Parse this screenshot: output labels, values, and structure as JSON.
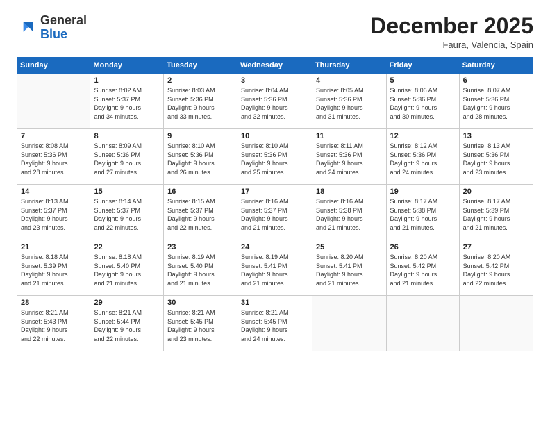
{
  "logo": {
    "line1": "General",
    "line2": "Blue"
  },
  "header": {
    "month": "December 2025",
    "location": "Faura, Valencia, Spain"
  },
  "weekdays": [
    "Sunday",
    "Monday",
    "Tuesday",
    "Wednesday",
    "Thursday",
    "Friday",
    "Saturday"
  ],
  "weeks": [
    [
      {
        "day": "",
        "info": ""
      },
      {
        "day": "1",
        "info": "Sunrise: 8:02 AM\nSunset: 5:37 PM\nDaylight: 9 hours\nand 34 minutes."
      },
      {
        "day": "2",
        "info": "Sunrise: 8:03 AM\nSunset: 5:36 PM\nDaylight: 9 hours\nand 33 minutes."
      },
      {
        "day": "3",
        "info": "Sunrise: 8:04 AM\nSunset: 5:36 PM\nDaylight: 9 hours\nand 32 minutes."
      },
      {
        "day": "4",
        "info": "Sunrise: 8:05 AM\nSunset: 5:36 PM\nDaylight: 9 hours\nand 31 minutes."
      },
      {
        "day": "5",
        "info": "Sunrise: 8:06 AM\nSunset: 5:36 PM\nDaylight: 9 hours\nand 30 minutes."
      },
      {
        "day": "6",
        "info": "Sunrise: 8:07 AM\nSunset: 5:36 PM\nDaylight: 9 hours\nand 28 minutes."
      }
    ],
    [
      {
        "day": "7",
        "info": "Sunrise: 8:08 AM\nSunset: 5:36 PM\nDaylight: 9 hours\nand 28 minutes."
      },
      {
        "day": "8",
        "info": "Sunrise: 8:09 AM\nSunset: 5:36 PM\nDaylight: 9 hours\nand 27 minutes."
      },
      {
        "day": "9",
        "info": "Sunrise: 8:10 AM\nSunset: 5:36 PM\nDaylight: 9 hours\nand 26 minutes."
      },
      {
        "day": "10",
        "info": "Sunrise: 8:10 AM\nSunset: 5:36 PM\nDaylight: 9 hours\nand 25 minutes."
      },
      {
        "day": "11",
        "info": "Sunrise: 8:11 AM\nSunset: 5:36 PM\nDaylight: 9 hours\nand 24 minutes."
      },
      {
        "day": "12",
        "info": "Sunrise: 8:12 AM\nSunset: 5:36 PM\nDaylight: 9 hours\nand 24 minutes."
      },
      {
        "day": "13",
        "info": "Sunrise: 8:13 AM\nSunset: 5:36 PM\nDaylight: 9 hours\nand 23 minutes."
      }
    ],
    [
      {
        "day": "14",
        "info": "Sunrise: 8:13 AM\nSunset: 5:37 PM\nDaylight: 9 hours\nand 23 minutes."
      },
      {
        "day": "15",
        "info": "Sunrise: 8:14 AM\nSunset: 5:37 PM\nDaylight: 9 hours\nand 22 minutes."
      },
      {
        "day": "16",
        "info": "Sunrise: 8:15 AM\nSunset: 5:37 PM\nDaylight: 9 hours\nand 22 minutes."
      },
      {
        "day": "17",
        "info": "Sunrise: 8:16 AM\nSunset: 5:37 PM\nDaylight: 9 hours\nand 21 minutes."
      },
      {
        "day": "18",
        "info": "Sunrise: 8:16 AM\nSunset: 5:38 PM\nDaylight: 9 hours\nand 21 minutes."
      },
      {
        "day": "19",
        "info": "Sunrise: 8:17 AM\nSunset: 5:38 PM\nDaylight: 9 hours\nand 21 minutes."
      },
      {
        "day": "20",
        "info": "Sunrise: 8:17 AM\nSunset: 5:39 PM\nDaylight: 9 hours\nand 21 minutes."
      }
    ],
    [
      {
        "day": "21",
        "info": "Sunrise: 8:18 AM\nSunset: 5:39 PM\nDaylight: 9 hours\nand 21 minutes."
      },
      {
        "day": "22",
        "info": "Sunrise: 8:18 AM\nSunset: 5:40 PM\nDaylight: 9 hours\nand 21 minutes."
      },
      {
        "day": "23",
        "info": "Sunrise: 8:19 AM\nSunset: 5:40 PM\nDaylight: 9 hours\nand 21 minutes."
      },
      {
        "day": "24",
        "info": "Sunrise: 8:19 AM\nSunset: 5:41 PM\nDaylight: 9 hours\nand 21 minutes."
      },
      {
        "day": "25",
        "info": "Sunrise: 8:20 AM\nSunset: 5:41 PM\nDaylight: 9 hours\nand 21 minutes."
      },
      {
        "day": "26",
        "info": "Sunrise: 8:20 AM\nSunset: 5:42 PM\nDaylight: 9 hours\nand 21 minutes."
      },
      {
        "day": "27",
        "info": "Sunrise: 8:20 AM\nSunset: 5:42 PM\nDaylight: 9 hours\nand 22 minutes."
      }
    ],
    [
      {
        "day": "28",
        "info": "Sunrise: 8:21 AM\nSunset: 5:43 PM\nDaylight: 9 hours\nand 22 minutes."
      },
      {
        "day": "29",
        "info": "Sunrise: 8:21 AM\nSunset: 5:44 PM\nDaylight: 9 hours\nand 22 minutes."
      },
      {
        "day": "30",
        "info": "Sunrise: 8:21 AM\nSunset: 5:45 PM\nDaylight: 9 hours\nand 23 minutes."
      },
      {
        "day": "31",
        "info": "Sunrise: 8:21 AM\nSunset: 5:45 PM\nDaylight: 9 hours\nand 24 minutes."
      },
      {
        "day": "",
        "info": ""
      },
      {
        "day": "",
        "info": ""
      },
      {
        "day": "",
        "info": ""
      }
    ]
  ]
}
